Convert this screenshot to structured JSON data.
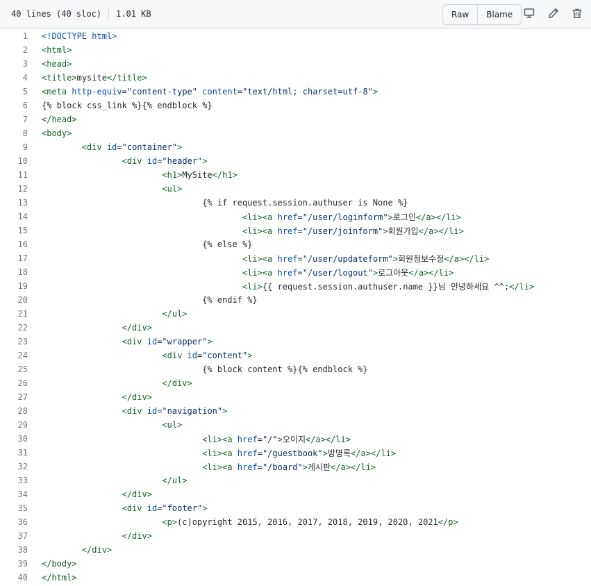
{
  "file_info": {
    "lines_label": "40 lines (40 sloc)",
    "size_label": "1.01 KB"
  },
  "toolbar": {
    "raw_label": "Raw",
    "blame_label": "Blame",
    "icons": [
      "desktop-icon",
      "pencil-icon",
      "trash-icon"
    ]
  },
  "colors": {
    "tag": "#116329",
    "attr": "#0550ae",
    "string": "#0a3069",
    "text": "#24292f",
    "line_number": "#6e7781"
  },
  "code_lines": [
    "<!DOCTYPE html>",
    "<html>",
    "<head>",
    "<title>mysite</title>",
    "<meta http-equiv=\"content-type\" content=\"text/html; charset=utf-8\">",
    "{% block css_link %}{% endblock %}",
    "</head>",
    "<body>",
    "\t<div id=\"container\">",
    "\t\t<div id=\"header\">",
    "\t\t\t<h1>MySite</h1>",
    "\t\t\t<ul>",
    "\t\t\t\t{% if request.session.authuser is None %}",
    "\t\t\t\t\t<li><a href=\"/user/loginform\">로그인</a></li>",
    "\t\t\t\t\t<li><a href=\"/user/joinform\">회원가입</a></li>",
    "\t\t\t\t{% else %}",
    "\t\t\t\t\t<li><a href=\"/user/updateform\">회원정보수정</a></li>",
    "\t\t\t\t\t<li><a href=\"/user/logout\">로그아웃</a></li>",
    "\t\t\t\t\t<li>{{ request.session.authuser.name }}님 안녕하세요 ^^;</li>",
    "\t\t\t\t{% endif %}",
    "\t\t\t</ul>",
    "\t\t</div>",
    "\t\t<div id=\"wrapper\">",
    "\t\t\t<div id=\"content\">",
    "\t\t\t\t{% block content %}{% endblock %}",
    "\t\t\t</div>",
    "\t\t</div>",
    "\t\t<div id=\"navigation\">",
    "\t\t\t<ul>",
    "\t\t\t\t<li><a href=\"/\">오이지</a></li>",
    "\t\t\t\t<li><a href=\"/guestbook\">방명록</a></li>",
    "\t\t\t\t<li><a href=\"/board\">게시판</a></li>",
    "\t\t\t</ul>",
    "\t\t</div>",
    "\t\t<div id=\"footer\">",
    "\t\t\t<p>(c)opyright 2015, 2016, 2017, 2018, 2019, 2020, 2021</p>",
    "\t\t</div>",
    "\t</div>",
    "</body>",
    "</html>"
  ]
}
